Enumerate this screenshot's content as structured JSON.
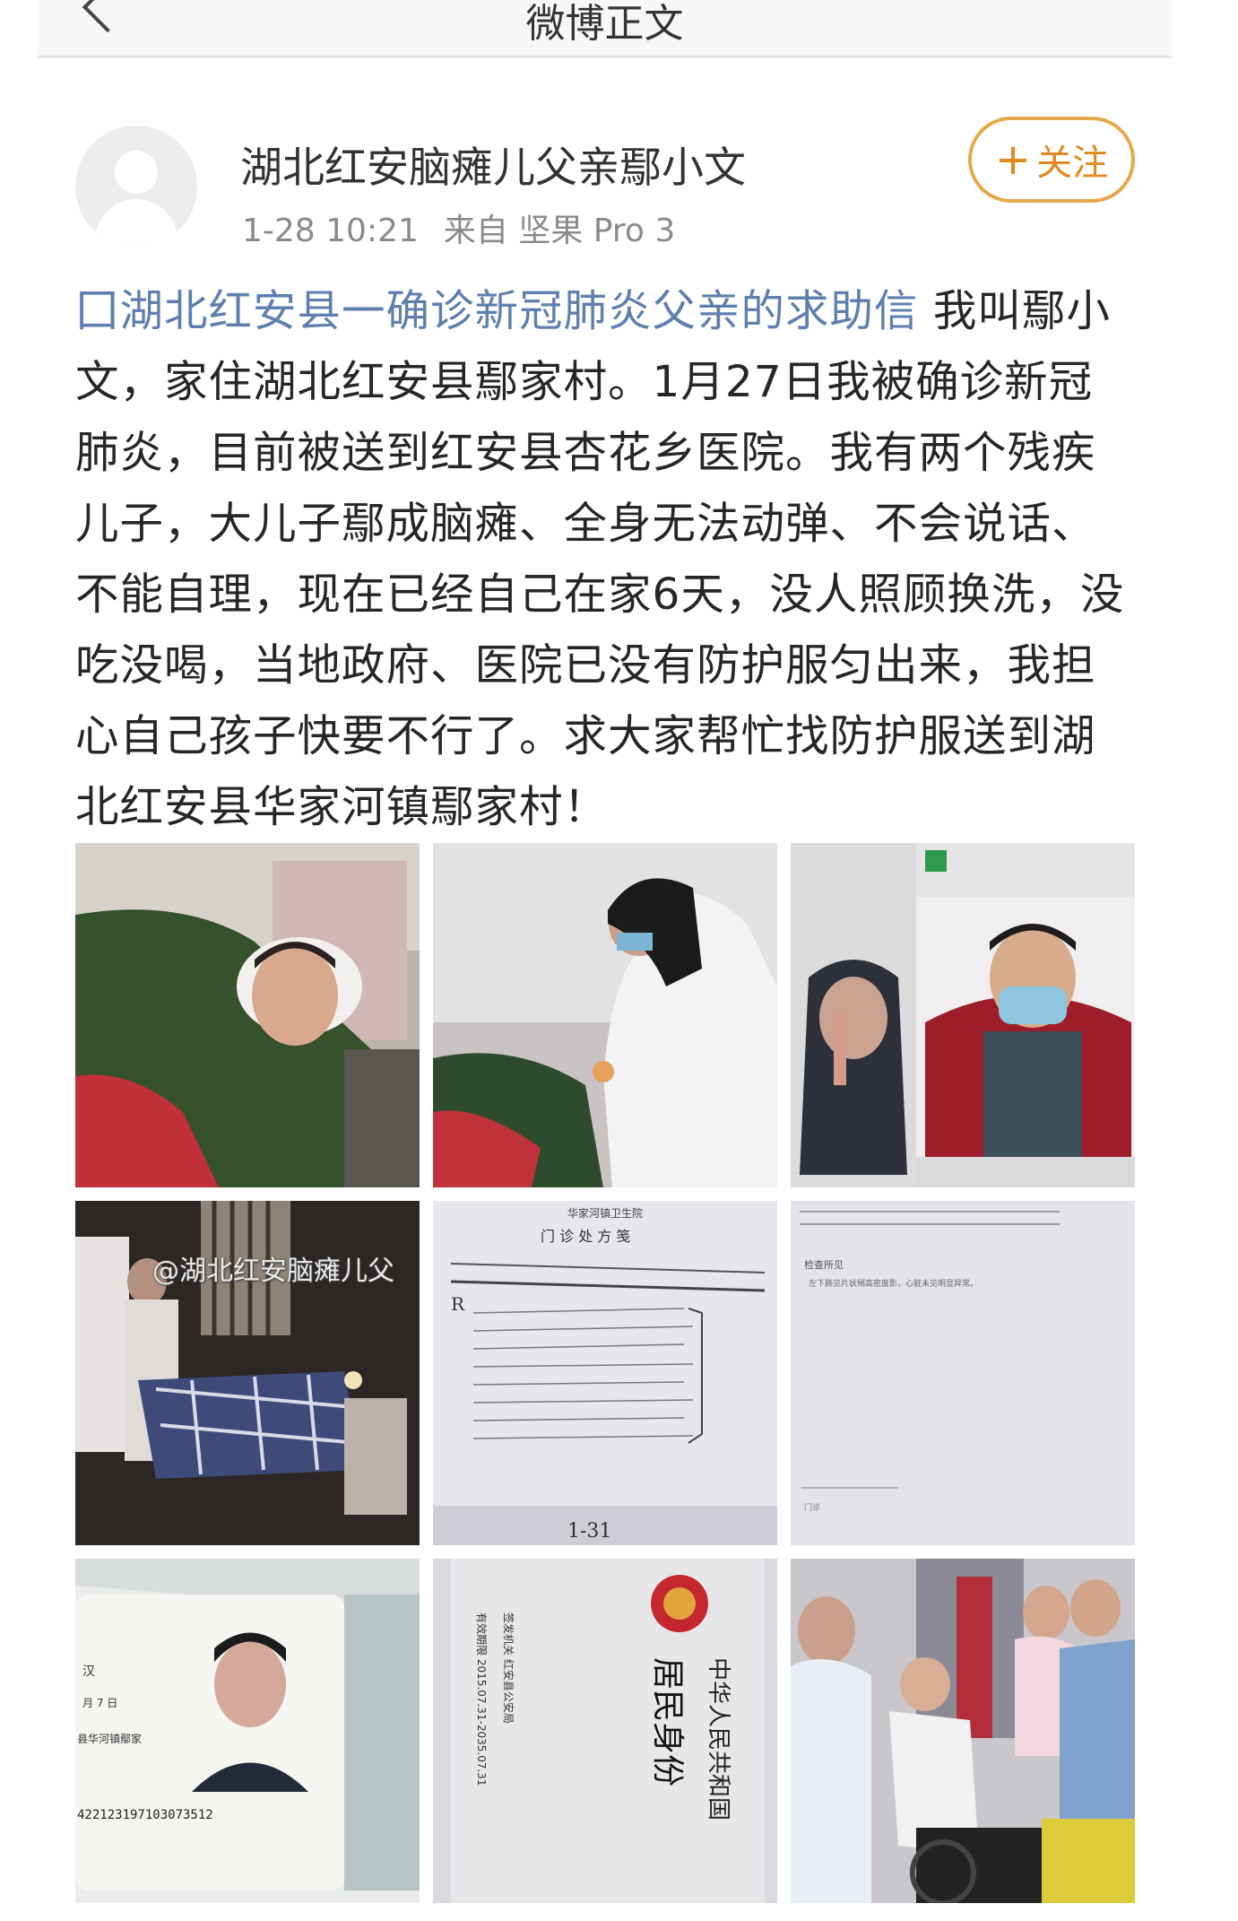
{
  "nav": {
    "title": "微博正文"
  },
  "author": {
    "name": "湖北红安脑瘫儿父亲鄢小文",
    "time": "1-28 10:21",
    "source": "来自 坚果 Pro 3"
  },
  "follow": {
    "plus": "+",
    "label": "关注"
  },
  "post": {
    "topic": "囗湖北红安县一确诊新冠肺炎父亲的求助信",
    "body": " 我叫鄢小文，家住湖北红安县鄢家村。1月27日我被确诊新冠肺炎，目前被送到红安县杏花乡医院。我有两个残疾儿子，大儿子鄢成脑瘫、全身无法动弹、不会说话、不能自理，现在已经自己在家6天，没人照顾换洗，没吃没喝，当地政府、医院已没有防护服匀出来，我担心自己孩子快要不行了。求大家帮忙找防护服送到湖北红安县华家河镇鄢家村！"
  },
  "photos": [
    {
      "id": "boy-in-bed"
    },
    {
      "id": "doctor-visit"
    },
    {
      "id": "two-boys"
    },
    {
      "id": "night-stretcher"
    },
    {
      "id": "prescription-slip"
    },
    {
      "id": "medical-record"
    },
    {
      "id": "id-card-front"
    },
    {
      "id": "id-card-back"
    },
    {
      "id": "crowd-wheelchair"
    }
  ],
  "id_card": {
    "ethnic": "汉",
    "month_day": "月 7 日",
    "address": "县华河镇鄢家",
    "number": "422123197103073512"
  },
  "id_back": {
    "title": "中华人民共和国",
    "subtitle": "居民身份",
    "issuer": "签发机关 红安县公安局",
    "validity": "有效期限 2015.07.31-2035.07.31"
  },
  "prescription": {
    "header": "华家河镇卫生院",
    "title": "门 诊 处 方 笺",
    "rx": "R",
    "date_mark": "1-31"
  },
  "record": {
    "line1": "检查所见",
    "line2": "左下肺见片状稍高密度影，心脏未见明显异常。"
  },
  "clinic_sign": {
    "text": "门诊"
  },
  "watermark": "@湖北红安脑瘫儿父",
  "colors": {
    "topic": "#5f7fae",
    "follow": "#e08a1e",
    "meta": "#8a8a8a"
  }
}
